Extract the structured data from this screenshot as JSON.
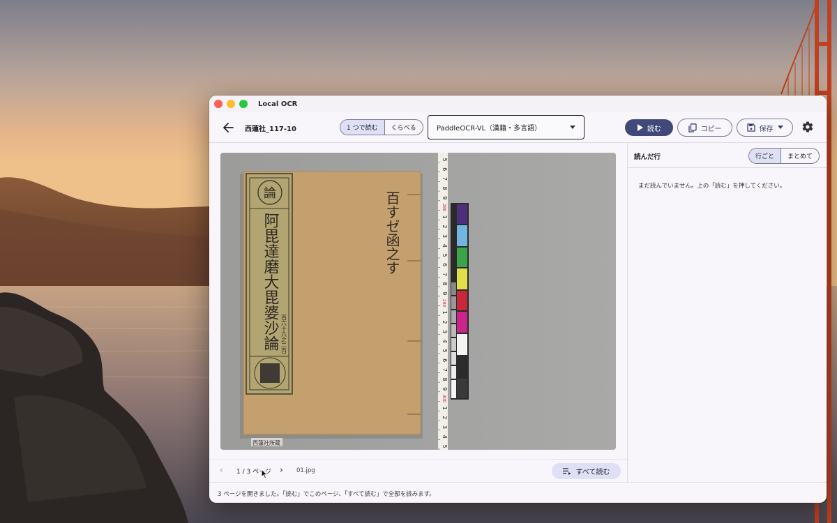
{
  "window": {
    "title": "Local OCR"
  },
  "toolbar": {
    "document_title": "西蓮社_117-10",
    "mode_tabs": [
      {
        "label": "1 つで読む",
        "active": true
      },
      {
        "label": "くらべる",
        "active": false
      }
    ],
    "model_select": {
      "value": "PaddleOCR-VL（漢籍・多言語）"
    },
    "read_button": "読む",
    "copy_button": "コピー",
    "save_button": "保存"
  },
  "viewer": {
    "stamp_text": "西蓮社所蔵",
    "cover_small_char": "論",
    "cover_title": "阿毘達磨大毘婆沙論",
    "cover_subtitle": "百六十六之二百",
    "handwriting": "百すゼ函之す",
    "ruler_marks": [
      "5",
      "6",
      "7",
      "8",
      "9",
      "280",
      "1",
      "2",
      "3",
      "4",
      "5",
      "6",
      "7",
      "8",
      "9",
      "290",
      "1",
      "2",
      "3",
      "4",
      "5",
      "6",
      "7",
      "8",
      "9",
      "300",
      "1",
      "2",
      "3",
      "4",
      "5"
    ]
  },
  "pager": {
    "label": "1 / 3 ページ",
    "filename": "01.jpg",
    "read_all_button": "すべて読む"
  },
  "side": {
    "heading": "読んだ行",
    "view_tabs": [
      {
        "label": "行ごと",
        "active": true
      },
      {
        "label": "まとめて",
        "active": false
      }
    ],
    "empty_message": "まだ読んでいません。上の「読む」を押してください。"
  },
  "status": "3 ページを開きました。「読む」でこのページ、「すべて読む」で全部を読みます。",
  "colors": {
    "accent": "#40497a",
    "tab_active": "#dfe0f6",
    "window_bg": "#f8f6fb"
  }
}
